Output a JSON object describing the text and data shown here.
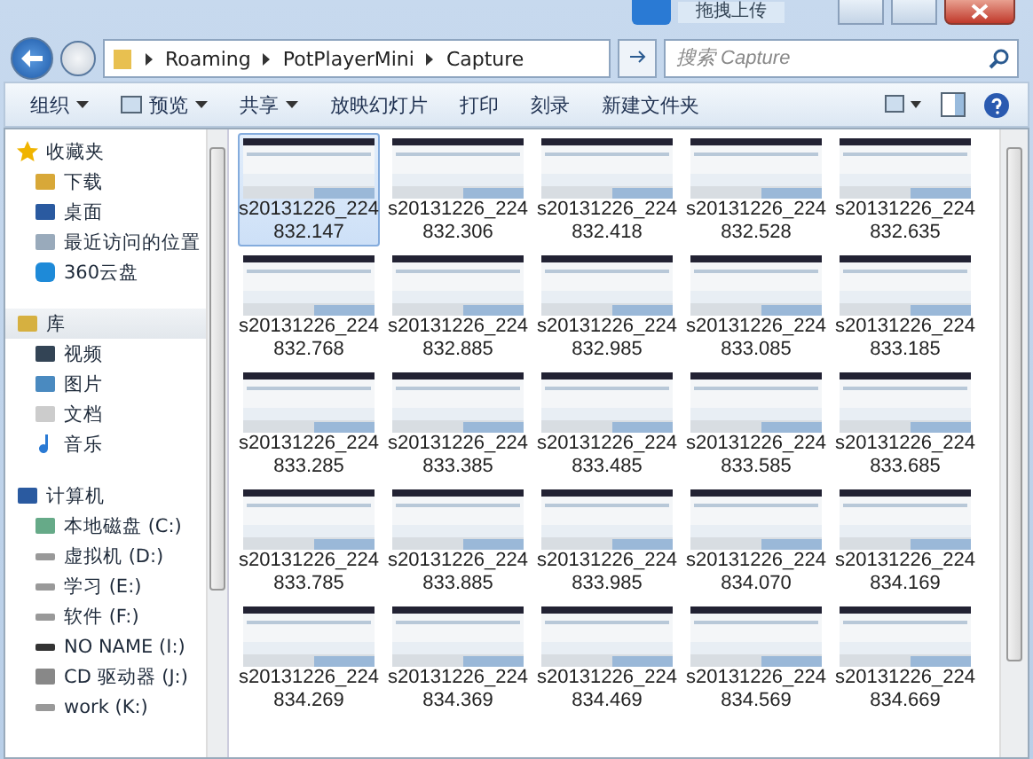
{
  "window": {
    "badge": "拖拽上传"
  },
  "address": {
    "segments": [
      "Roaming",
      "PotPlayerMini",
      "Capture"
    ]
  },
  "search": {
    "placeholder": "搜索 Capture"
  },
  "toolbar": [
    {
      "label": "组织",
      "dropdown": true
    },
    {
      "label": "预览",
      "dropdown": true
    },
    {
      "label": "共享",
      "dropdown": true
    },
    {
      "label": "放映幻灯片",
      "dropdown": false
    },
    {
      "label": "打印",
      "dropdown": false
    },
    {
      "label": "刻录",
      "dropdown": false
    },
    {
      "label": "新建文件夹",
      "dropdown": false
    }
  ],
  "sidebar": [
    {
      "label": "收藏夹",
      "selected": false,
      "children": [
        {
          "label": "下载"
        },
        {
          "label": "桌面"
        },
        {
          "label": "最近访问的位置"
        },
        {
          "label": "360云盘"
        }
      ]
    },
    {
      "label": "库",
      "selected": true,
      "children": [
        {
          "label": "视频"
        },
        {
          "label": "图片"
        },
        {
          "label": "文档"
        },
        {
          "label": "音乐"
        }
      ]
    },
    {
      "label": "计算机",
      "selected": false,
      "children": [
        {
          "label": "本地磁盘 (C:)"
        },
        {
          "label": "虚拟机 (D:)"
        },
        {
          "label": "学习 (E:)"
        },
        {
          "label": "软件 (F:)"
        },
        {
          "label": "NO NAME (I:)"
        },
        {
          "label": "CD 驱动器 (J:)"
        },
        {
          "label": "work (K:)"
        }
      ]
    }
  ],
  "files": [
    {
      "name": "s20131226_224832.147",
      "selected": true
    },
    {
      "name": "s20131226_224832.306",
      "selected": false
    },
    {
      "name": "s20131226_224832.418",
      "selected": false
    },
    {
      "name": "s20131226_224832.528",
      "selected": false
    },
    {
      "name": "s20131226_224832.635",
      "selected": false
    },
    {
      "name": "s20131226_224832.768",
      "selected": false
    },
    {
      "name": "s20131226_224832.885",
      "selected": false
    },
    {
      "name": "s20131226_224832.985",
      "selected": false
    },
    {
      "name": "s20131226_224833.085",
      "selected": false
    },
    {
      "name": "s20131226_224833.185",
      "selected": false
    },
    {
      "name": "s20131226_224833.285",
      "selected": false
    },
    {
      "name": "s20131226_224833.385",
      "selected": false
    },
    {
      "name": "s20131226_224833.485",
      "selected": false
    },
    {
      "name": "s20131226_224833.585",
      "selected": false
    },
    {
      "name": "s20131226_224833.685",
      "selected": false
    },
    {
      "name": "s20131226_224833.785",
      "selected": false
    },
    {
      "name": "s20131226_224833.885",
      "selected": false
    },
    {
      "name": "s20131226_224833.985",
      "selected": false
    },
    {
      "name": "s20131226_224834.070",
      "selected": false
    },
    {
      "name": "s20131226_224834.169",
      "selected": false
    },
    {
      "name": "s20131226_224834.269",
      "selected": false
    },
    {
      "name": "s20131226_224834.369",
      "selected": false
    },
    {
      "name": "s20131226_224834.469",
      "selected": false
    },
    {
      "name": "s20131226_224834.569",
      "selected": false
    },
    {
      "name": "s20131226_224834.669",
      "selected": false
    }
  ]
}
